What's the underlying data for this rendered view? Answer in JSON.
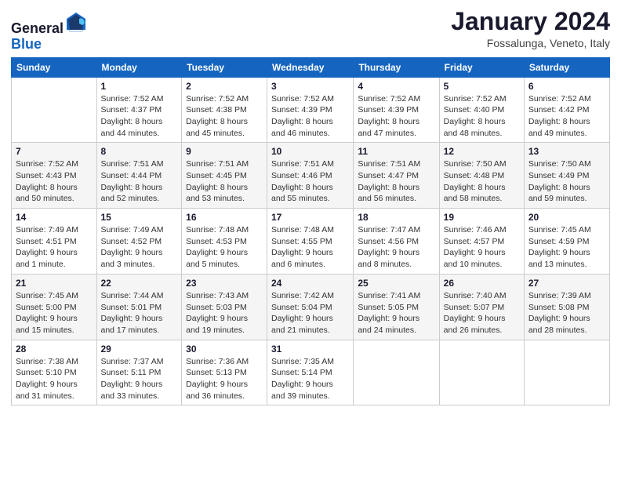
{
  "header": {
    "logo": {
      "line1": "General",
      "line2": "Blue"
    },
    "title": "January 2024",
    "location": "Fossalunga, Veneto, Italy"
  },
  "weekdays": [
    "Sunday",
    "Monday",
    "Tuesday",
    "Wednesday",
    "Thursday",
    "Friday",
    "Saturday"
  ],
  "weeks": [
    [
      {
        "day": "",
        "info": ""
      },
      {
        "day": "1",
        "info": "Sunrise: 7:52 AM\nSunset: 4:37 PM\nDaylight: 8 hours\nand 44 minutes."
      },
      {
        "day": "2",
        "info": "Sunrise: 7:52 AM\nSunset: 4:38 PM\nDaylight: 8 hours\nand 45 minutes."
      },
      {
        "day": "3",
        "info": "Sunrise: 7:52 AM\nSunset: 4:39 PM\nDaylight: 8 hours\nand 46 minutes."
      },
      {
        "day": "4",
        "info": "Sunrise: 7:52 AM\nSunset: 4:39 PM\nDaylight: 8 hours\nand 47 minutes."
      },
      {
        "day": "5",
        "info": "Sunrise: 7:52 AM\nSunset: 4:40 PM\nDaylight: 8 hours\nand 48 minutes."
      },
      {
        "day": "6",
        "info": "Sunrise: 7:52 AM\nSunset: 4:42 PM\nDaylight: 8 hours\nand 49 minutes."
      }
    ],
    [
      {
        "day": "7",
        "info": "Sunrise: 7:52 AM\nSunset: 4:43 PM\nDaylight: 8 hours\nand 50 minutes."
      },
      {
        "day": "8",
        "info": "Sunrise: 7:51 AM\nSunset: 4:44 PM\nDaylight: 8 hours\nand 52 minutes."
      },
      {
        "day": "9",
        "info": "Sunrise: 7:51 AM\nSunset: 4:45 PM\nDaylight: 8 hours\nand 53 minutes."
      },
      {
        "day": "10",
        "info": "Sunrise: 7:51 AM\nSunset: 4:46 PM\nDaylight: 8 hours\nand 55 minutes."
      },
      {
        "day": "11",
        "info": "Sunrise: 7:51 AM\nSunset: 4:47 PM\nDaylight: 8 hours\nand 56 minutes."
      },
      {
        "day": "12",
        "info": "Sunrise: 7:50 AM\nSunset: 4:48 PM\nDaylight: 8 hours\nand 58 minutes."
      },
      {
        "day": "13",
        "info": "Sunrise: 7:50 AM\nSunset: 4:49 PM\nDaylight: 8 hours\nand 59 minutes."
      }
    ],
    [
      {
        "day": "14",
        "info": "Sunrise: 7:49 AM\nSunset: 4:51 PM\nDaylight: 9 hours\nand 1 minute."
      },
      {
        "day": "15",
        "info": "Sunrise: 7:49 AM\nSunset: 4:52 PM\nDaylight: 9 hours\nand 3 minutes."
      },
      {
        "day": "16",
        "info": "Sunrise: 7:48 AM\nSunset: 4:53 PM\nDaylight: 9 hours\nand 5 minutes."
      },
      {
        "day": "17",
        "info": "Sunrise: 7:48 AM\nSunset: 4:55 PM\nDaylight: 9 hours\nand 6 minutes."
      },
      {
        "day": "18",
        "info": "Sunrise: 7:47 AM\nSunset: 4:56 PM\nDaylight: 9 hours\nand 8 minutes."
      },
      {
        "day": "19",
        "info": "Sunrise: 7:46 AM\nSunset: 4:57 PM\nDaylight: 9 hours\nand 10 minutes."
      },
      {
        "day": "20",
        "info": "Sunrise: 7:45 AM\nSunset: 4:59 PM\nDaylight: 9 hours\nand 13 minutes."
      }
    ],
    [
      {
        "day": "21",
        "info": "Sunrise: 7:45 AM\nSunset: 5:00 PM\nDaylight: 9 hours\nand 15 minutes."
      },
      {
        "day": "22",
        "info": "Sunrise: 7:44 AM\nSunset: 5:01 PM\nDaylight: 9 hours\nand 17 minutes."
      },
      {
        "day": "23",
        "info": "Sunrise: 7:43 AM\nSunset: 5:03 PM\nDaylight: 9 hours\nand 19 minutes."
      },
      {
        "day": "24",
        "info": "Sunrise: 7:42 AM\nSunset: 5:04 PM\nDaylight: 9 hours\nand 21 minutes."
      },
      {
        "day": "25",
        "info": "Sunrise: 7:41 AM\nSunset: 5:05 PM\nDaylight: 9 hours\nand 24 minutes."
      },
      {
        "day": "26",
        "info": "Sunrise: 7:40 AM\nSunset: 5:07 PM\nDaylight: 9 hours\nand 26 minutes."
      },
      {
        "day": "27",
        "info": "Sunrise: 7:39 AM\nSunset: 5:08 PM\nDaylight: 9 hours\nand 28 minutes."
      }
    ],
    [
      {
        "day": "28",
        "info": "Sunrise: 7:38 AM\nSunset: 5:10 PM\nDaylight: 9 hours\nand 31 minutes."
      },
      {
        "day": "29",
        "info": "Sunrise: 7:37 AM\nSunset: 5:11 PM\nDaylight: 9 hours\nand 33 minutes."
      },
      {
        "day": "30",
        "info": "Sunrise: 7:36 AM\nSunset: 5:13 PM\nDaylight: 9 hours\nand 36 minutes."
      },
      {
        "day": "31",
        "info": "Sunrise: 7:35 AM\nSunset: 5:14 PM\nDaylight: 9 hours\nand 39 minutes."
      },
      {
        "day": "",
        "info": ""
      },
      {
        "day": "",
        "info": ""
      },
      {
        "day": "",
        "info": ""
      }
    ]
  ]
}
